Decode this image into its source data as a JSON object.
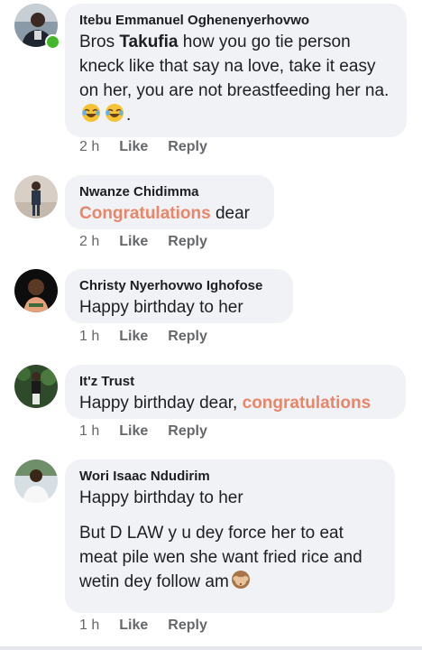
{
  "comments": [
    {
      "author": "Itebu Emmanuel Oghenenyerhovwo",
      "text_1": "Bros ",
      "mention": "Takufia",
      "text_2": " how you go tie person kneck like that say na love, take it easy on her, you are not breastfeeding her na. ",
      "text_3": ".",
      "emojis": [
        "joy-emoji",
        "joy-emoji"
      ],
      "time": "2 h",
      "like": "Like",
      "reply": "Reply",
      "online": true
    },
    {
      "author": "Nwanze Chidimma",
      "tag": "Congratulations",
      "text": " dear",
      "time": "2 h",
      "like": "Like",
      "reply": "Reply"
    },
    {
      "author": "Christy Nyerhovwo Ighofose",
      "text": "Happy birthday to her",
      "time": "1 h",
      "like": "Like",
      "reply": "Reply"
    },
    {
      "author": "It'z Trust",
      "text": "Happy birthday dear, ",
      "tag": "congratulations",
      "time": "1 h",
      "like": "Like",
      "reply": "Reply"
    },
    {
      "author": "Wori Isaac Ndudirim",
      "line_1": "Happy birthday to her",
      "line_2": "But D LAW y u dey force her to eat meat pile wen she want fried rice and wetin dey follow am",
      "emojis": [
        "see-no-evil-monkey-emoji"
      ],
      "time": "1 h",
      "like": "Like",
      "reply": "Reply"
    }
  ]
}
